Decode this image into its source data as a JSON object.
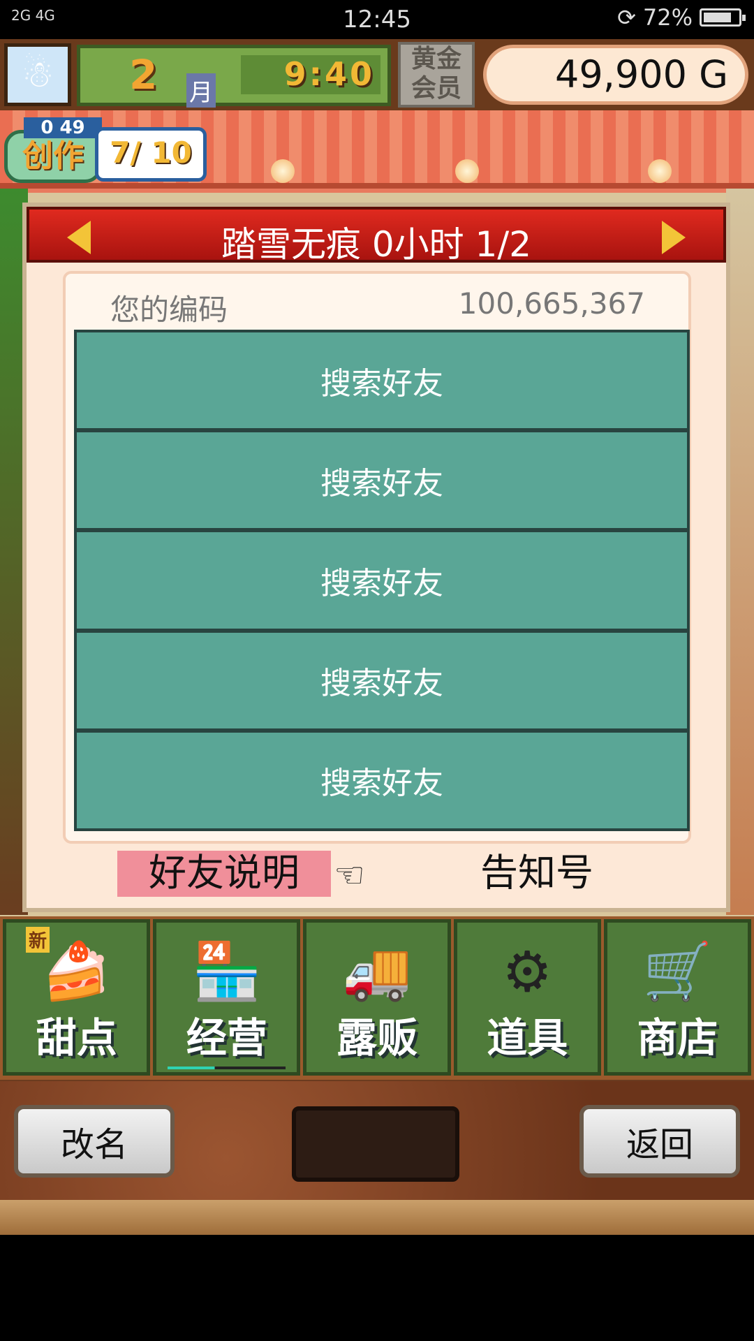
{
  "status_bar": {
    "signal": "2G 4G",
    "time": "12:45",
    "battery": "72%"
  },
  "hud": {
    "month_number": "2",
    "month_label": "月",
    "clock": "9:40",
    "member_badge": "黄金会员",
    "money": "49,900 G"
  },
  "create": {
    "count": "0 49",
    "label": "创作",
    "progress": "7/ 10"
  },
  "dialog": {
    "title": "踏雪无痕  0小时 1/2",
    "code_label": "您的编码",
    "code_value": "100,665,367",
    "slots": [
      "搜索好友",
      "搜索好友",
      "搜索好友",
      "搜索好友",
      "搜索好友"
    ],
    "explain_label": "好友说明",
    "notify_label": "告知号"
  },
  "menu": {
    "items": [
      {
        "label": "甜点",
        "tag": "新",
        "icon": "cake-icon"
      },
      {
        "label": "经营",
        "icon": "shop-building-icon"
      },
      {
        "label": "露贩",
        "icon": "food-truck-icon"
      },
      {
        "label": "道具",
        "icon": "gear-bag-icon"
      },
      {
        "label": "商店",
        "icon": "shopping-cart-icon"
      }
    ]
  },
  "bottom": {
    "rename_label": "改名",
    "back_label": "返回"
  }
}
